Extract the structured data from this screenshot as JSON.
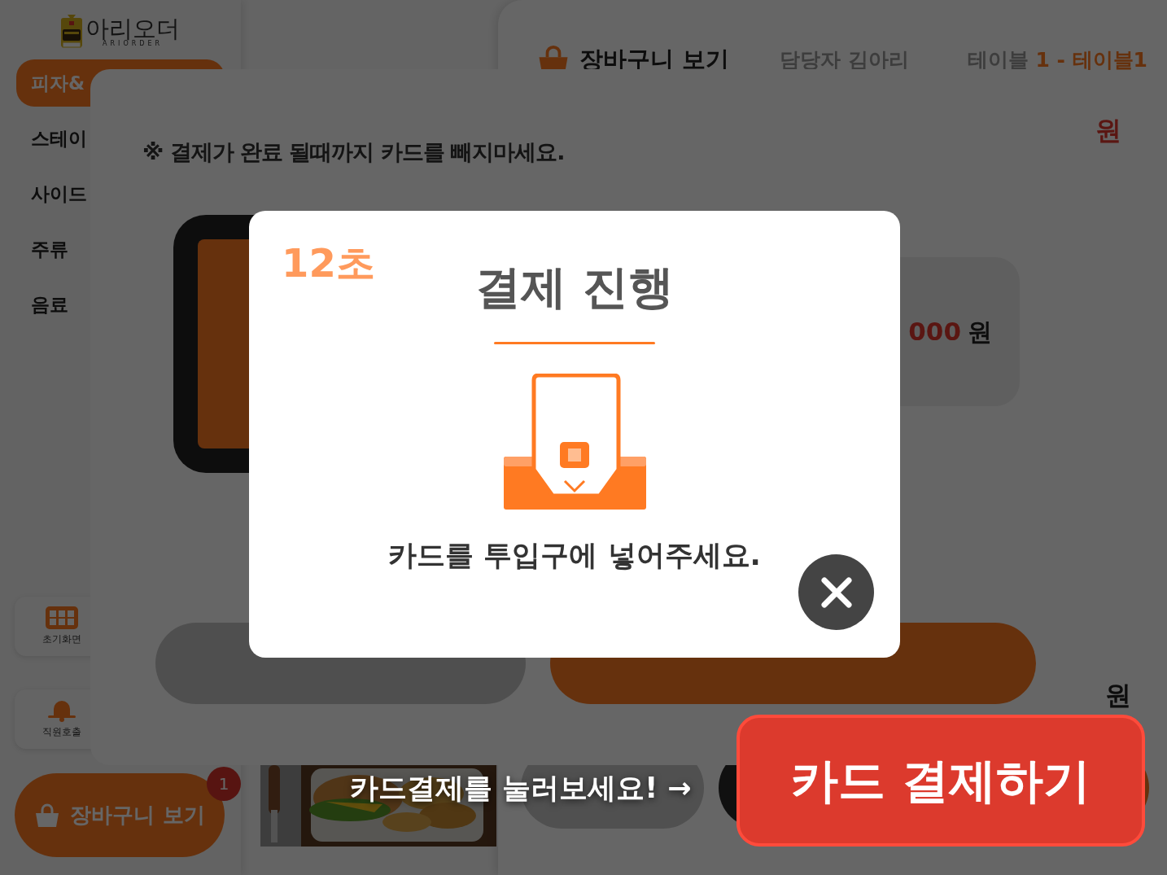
{
  "sidebar": {
    "logo_text": "아리오더",
    "logo_subtext": "ARIORDER",
    "categories": [
      {
        "label": "피자&",
        "selected": true
      },
      {
        "label": "스테이",
        "selected": false
      },
      {
        "label": "사이드",
        "selected": false
      },
      {
        "label": "주류",
        "selected": false
      },
      {
        "label": "음료",
        "selected": false
      }
    ],
    "shortcuts": [
      {
        "kind": "grid",
        "label": "초기화면"
      },
      {
        "kind": "bell",
        "label": "직원호출"
      }
    ],
    "cart_button": {
      "label": "장바구니 보기",
      "badge": "1"
    }
  },
  "cart_panel": {
    "title": "장바구니 보기",
    "staff": "담당자 김아리",
    "table_label": "테이블",
    "table_value": "1 - 테이블1",
    "total": "원",
    "line_unit": "원"
  },
  "payment_modal": {
    "notice": "※ 결제가 완료 될때까지 카드를 빼지마세요.",
    "amount": "000",
    "amount_unit": "원",
    "buttons": [
      {
        "kind": "cancel"
      },
      {
        "kind": "confirm"
      }
    ]
  },
  "progress_dialog": {
    "countdown": "12초",
    "title": "결제 진행",
    "message": "카드를 투입구에 넣어주세요."
  },
  "tutorial": {
    "hint": "카드결제를 눌러보세요! →",
    "button": "카드 결제하기"
  }
}
